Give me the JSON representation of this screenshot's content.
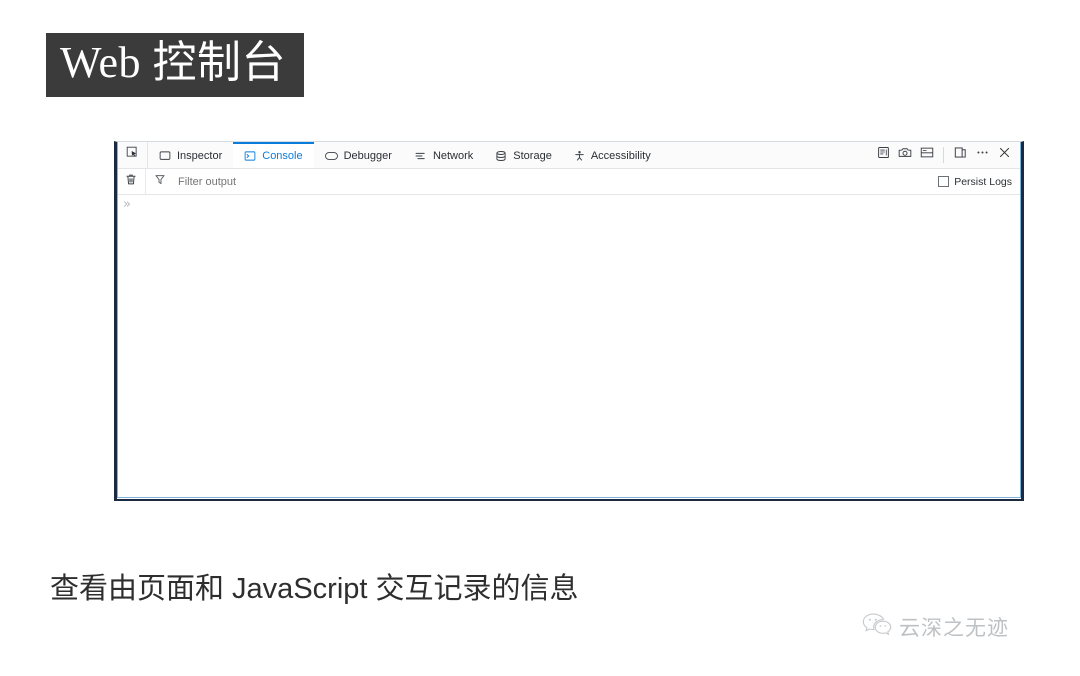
{
  "slide": {
    "title": "Web 控制台",
    "caption": "查看由页面和 JavaScript 交互记录的信息",
    "watermark_text": "云深之无迹",
    "title_bg_color": "#3b3b3b",
    "title_text_color": "#ffffff",
    "accent_color": "#0a7cdb",
    "panel_border_color": "#1b2a41"
  },
  "devtools": {
    "picker_tooltip": "Pick an element from the page",
    "tabs": [
      {
        "label": "Inspector",
        "icon": "inspector-icon",
        "selected": false
      },
      {
        "label": "Console",
        "icon": "console-icon",
        "selected": true
      },
      {
        "label": "Debugger",
        "icon": "debugger-icon",
        "selected": false
      },
      {
        "label": "Network",
        "icon": "network-icon",
        "selected": false
      },
      {
        "label": "Storage",
        "icon": "storage-icon",
        "selected": false
      },
      {
        "label": "Accessibility",
        "icon": "accessibility-icon",
        "selected": false
      }
    ],
    "tool_icons": [
      {
        "name": "responsive-design-mode-icon"
      },
      {
        "name": "screenshot-camera-icon"
      },
      {
        "name": "split-console-icon"
      },
      {
        "name": "dock-to-side-icon"
      },
      {
        "name": "meatball-menu-icon"
      },
      {
        "name": "close-icon"
      }
    ],
    "filterbar": {
      "clear_icon": "trash-icon",
      "funnel_icon": "filter-funnel-icon",
      "filter_placeholder": "Filter output",
      "filter_value": "",
      "persist_logs_label": "Persist Logs",
      "persist_logs_checked": false
    },
    "console": {
      "prompt_glyph": "»",
      "messages": []
    }
  }
}
